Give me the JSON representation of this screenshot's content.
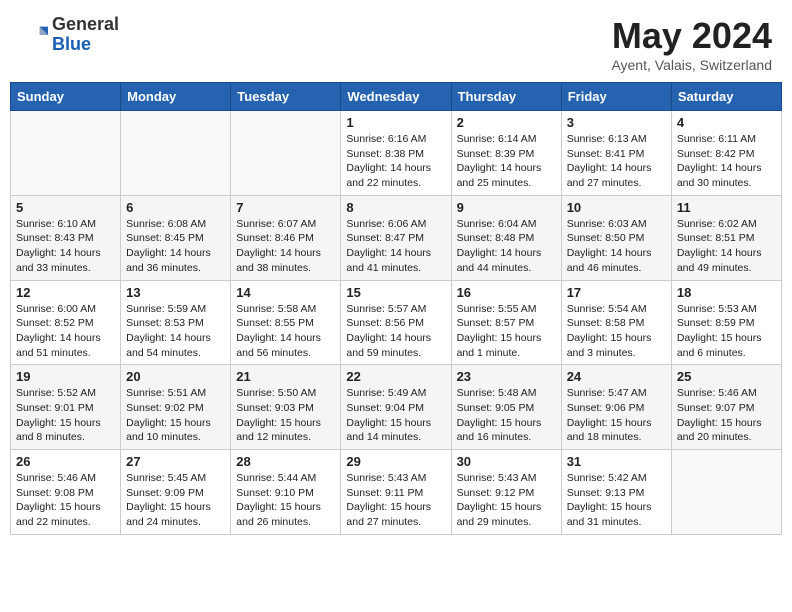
{
  "header": {
    "logo_general": "General",
    "logo_blue": "Blue",
    "month": "May 2024",
    "location": "Ayent, Valais, Switzerland"
  },
  "days_of_week": [
    "Sunday",
    "Monday",
    "Tuesday",
    "Wednesday",
    "Thursday",
    "Friday",
    "Saturday"
  ],
  "weeks": [
    [
      {
        "day": "",
        "info": ""
      },
      {
        "day": "",
        "info": ""
      },
      {
        "day": "",
        "info": ""
      },
      {
        "day": "1",
        "info": "Sunrise: 6:16 AM\nSunset: 8:38 PM\nDaylight: 14 hours\nand 22 minutes."
      },
      {
        "day": "2",
        "info": "Sunrise: 6:14 AM\nSunset: 8:39 PM\nDaylight: 14 hours\nand 25 minutes."
      },
      {
        "day": "3",
        "info": "Sunrise: 6:13 AM\nSunset: 8:41 PM\nDaylight: 14 hours\nand 27 minutes."
      },
      {
        "day": "4",
        "info": "Sunrise: 6:11 AM\nSunset: 8:42 PM\nDaylight: 14 hours\nand 30 minutes."
      }
    ],
    [
      {
        "day": "5",
        "info": "Sunrise: 6:10 AM\nSunset: 8:43 PM\nDaylight: 14 hours\nand 33 minutes."
      },
      {
        "day": "6",
        "info": "Sunrise: 6:08 AM\nSunset: 8:45 PM\nDaylight: 14 hours\nand 36 minutes."
      },
      {
        "day": "7",
        "info": "Sunrise: 6:07 AM\nSunset: 8:46 PM\nDaylight: 14 hours\nand 38 minutes."
      },
      {
        "day": "8",
        "info": "Sunrise: 6:06 AM\nSunset: 8:47 PM\nDaylight: 14 hours\nand 41 minutes."
      },
      {
        "day": "9",
        "info": "Sunrise: 6:04 AM\nSunset: 8:48 PM\nDaylight: 14 hours\nand 44 minutes."
      },
      {
        "day": "10",
        "info": "Sunrise: 6:03 AM\nSunset: 8:50 PM\nDaylight: 14 hours\nand 46 minutes."
      },
      {
        "day": "11",
        "info": "Sunrise: 6:02 AM\nSunset: 8:51 PM\nDaylight: 14 hours\nand 49 minutes."
      }
    ],
    [
      {
        "day": "12",
        "info": "Sunrise: 6:00 AM\nSunset: 8:52 PM\nDaylight: 14 hours\nand 51 minutes."
      },
      {
        "day": "13",
        "info": "Sunrise: 5:59 AM\nSunset: 8:53 PM\nDaylight: 14 hours\nand 54 minutes."
      },
      {
        "day": "14",
        "info": "Sunrise: 5:58 AM\nSunset: 8:55 PM\nDaylight: 14 hours\nand 56 minutes."
      },
      {
        "day": "15",
        "info": "Sunrise: 5:57 AM\nSunset: 8:56 PM\nDaylight: 14 hours\nand 59 minutes."
      },
      {
        "day": "16",
        "info": "Sunrise: 5:55 AM\nSunset: 8:57 PM\nDaylight: 15 hours\nand 1 minute."
      },
      {
        "day": "17",
        "info": "Sunrise: 5:54 AM\nSunset: 8:58 PM\nDaylight: 15 hours\nand 3 minutes."
      },
      {
        "day": "18",
        "info": "Sunrise: 5:53 AM\nSunset: 8:59 PM\nDaylight: 15 hours\nand 6 minutes."
      }
    ],
    [
      {
        "day": "19",
        "info": "Sunrise: 5:52 AM\nSunset: 9:01 PM\nDaylight: 15 hours\nand 8 minutes."
      },
      {
        "day": "20",
        "info": "Sunrise: 5:51 AM\nSunset: 9:02 PM\nDaylight: 15 hours\nand 10 minutes."
      },
      {
        "day": "21",
        "info": "Sunrise: 5:50 AM\nSunset: 9:03 PM\nDaylight: 15 hours\nand 12 minutes."
      },
      {
        "day": "22",
        "info": "Sunrise: 5:49 AM\nSunset: 9:04 PM\nDaylight: 15 hours\nand 14 minutes."
      },
      {
        "day": "23",
        "info": "Sunrise: 5:48 AM\nSunset: 9:05 PM\nDaylight: 15 hours\nand 16 minutes."
      },
      {
        "day": "24",
        "info": "Sunrise: 5:47 AM\nSunset: 9:06 PM\nDaylight: 15 hours\nand 18 minutes."
      },
      {
        "day": "25",
        "info": "Sunrise: 5:46 AM\nSunset: 9:07 PM\nDaylight: 15 hours\nand 20 minutes."
      }
    ],
    [
      {
        "day": "26",
        "info": "Sunrise: 5:46 AM\nSunset: 9:08 PM\nDaylight: 15 hours\nand 22 minutes."
      },
      {
        "day": "27",
        "info": "Sunrise: 5:45 AM\nSunset: 9:09 PM\nDaylight: 15 hours\nand 24 minutes."
      },
      {
        "day": "28",
        "info": "Sunrise: 5:44 AM\nSunset: 9:10 PM\nDaylight: 15 hours\nand 26 minutes."
      },
      {
        "day": "29",
        "info": "Sunrise: 5:43 AM\nSunset: 9:11 PM\nDaylight: 15 hours\nand 27 minutes."
      },
      {
        "day": "30",
        "info": "Sunrise: 5:43 AM\nSunset: 9:12 PM\nDaylight: 15 hours\nand 29 minutes."
      },
      {
        "day": "31",
        "info": "Sunrise: 5:42 AM\nSunset: 9:13 PM\nDaylight: 15 hours\nand 31 minutes."
      },
      {
        "day": "",
        "info": ""
      }
    ]
  ]
}
